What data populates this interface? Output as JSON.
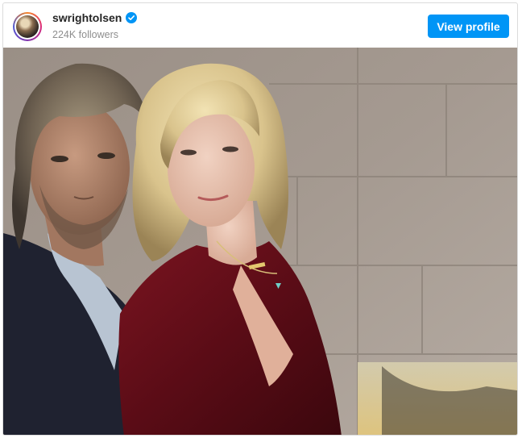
{
  "profile": {
    "username": "swrightolsen",
    "verified": true,
    "followers": "224K followers",
    "avatar_icon": "profile-avatar"
  },
  "actions": {
    "view_profile_label": "View profile"
  },
  "colors": {
    "accent": "#0095f6",
    "username": "#262626",
    "secondary_text": "#8e8e8e",
    "border": "#dbdbdb"
  },
  "icons": {
    "verified": "verified-badge-icon"
  }
}
